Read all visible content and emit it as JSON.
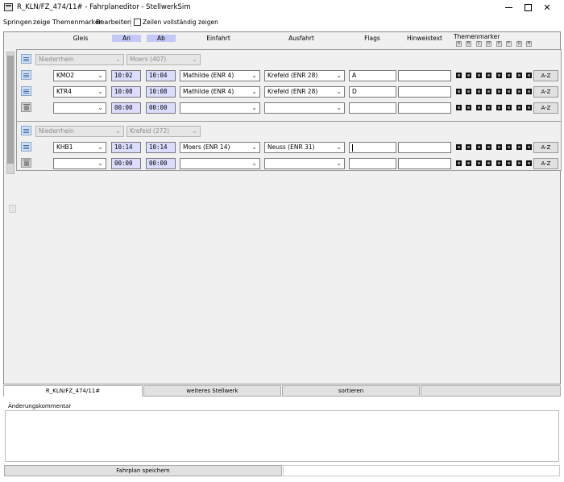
{
  "window": {
    "title": "R_KLN/FZ_474/11# - Fahrplaneditor - StellwerkSim"
  },
  "menu": {
    "items": [
      "Springen",
      "zeige Themenmarker",
      "Bearbeiten"
    ],
    "show_full_rows_label": "Zeilen vollständig zeigen"
  },
  "columns": {
    "gleis": "Gleis",
    "an": "An",
    "ab": "Ab",
    "einfahrt": "Einfahrt",
    "ausfahrt": "Ausfahrt",
    "flags": "Flags",
    "hinweistext": "Hinweistext",
    "themenmarker": "Themenmarker",
    "marker_letters": [
      "A",
      "B",
      "C",
      "D",
      "E",
      "F",
      "G",
      "H"
    ]
  },
  "groups": [
    {
      "stellwerk": "Niederrhein",
      "station": "Moers (407)",
      "rows": [
        {
          "gleis": "KMO2",
          "an": "10:02",
          "ab": "10:04",
          "einfahrt": "Mathilde (ENR 4)",
          "ausfahrt": "Krefeld (ENR 28)",
          "flags": "A",
          "hinweis": ""
        },
        {
          "gleis": "KTR4",
          "an": "10:08",
          "ab": "10:08",
          "einfahrt": "Mathilde (ENR 4)",
          "ausfahrt": "Krefeld (ENR 28)",
          "flags": "D",
          "hinweis": ""
        },
        {
          "gleis": "",
          "an": "00:00",
          "ab": "00:00",
          "einfahrt": "",
          "ausfahrt": "",
          "flags": "",
          "hinweis": ""
        }
      ]
    },
    {
      "stellwerk": "Niederrhein",
      "station": "Krefeld (272)",
      "rows": [
        {
          "gleis": "KHB1",
          "an": "10:14",
          "ab": "10:14",
          "einfahrt": "Moers (ENR 14)",
          "ausfahrt": "Neuss (ENR 31)",
          "flags": "",
          "hinweis": ""
        },
        {
          "gleis": "",
          "an": "00:00",
          "ab": "00:00",
          "einfahrt": "",
          "ausfahrt": "",
          "flags": "",
          "hinweis": ""
        }
      ]
    }
  ],
  "az_label": "A-Z",
  "tabs": [
    "R_KLN/FZ_474/11#",
    "weiteres Stellwerk",
    "sortieren"
  ],
  "comment_label": "Änderungskommentar",
  "save_button": "Fahrplan speichern"
}
